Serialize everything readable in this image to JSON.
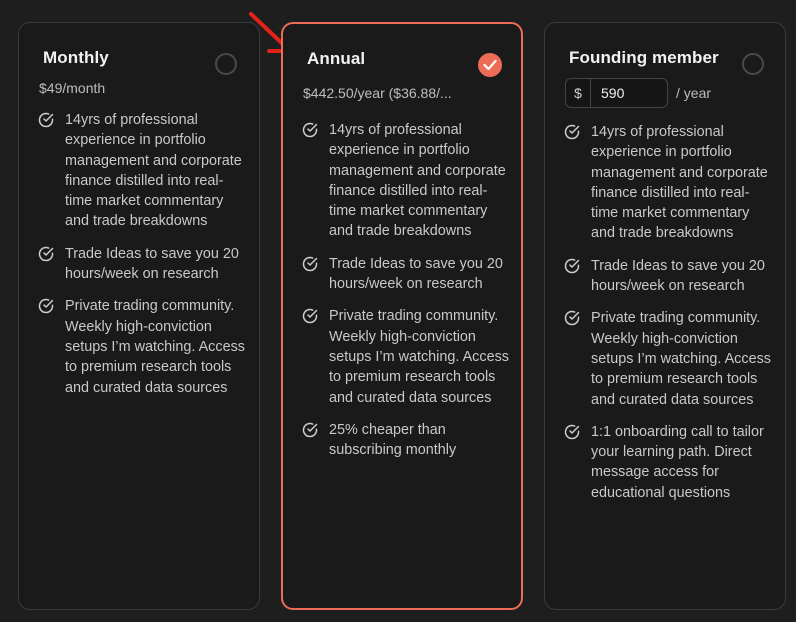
{
  "plans": {
    "monthly": {
      "title": "Monthly",
      "price": "$49/month",
      "features": [
        "14yrs of professional experience in portfolio management and corporate finance distilled into real-time market commentary and trade breakdowns",
        "Trade Ideas to save you 20 hours/week on research",
        "Private trading community. Weekly high-conviction setups I’m watching. Access to premium research tools and curated data sources"
      ]
    },
    "annual": {
      "title": "Annual",
      "price": "$442.50/year ($36.88/...",
      "selected": true,
      "features": [
        "14yrs of professional experience in portfolio management and corporate finance distilled into real-time market commentary and trade breakdowns",
        "Trade Ideas to save you 20 hours/week on research",
        "Private trading community. Weekly high-conviction setups I’m watching. Access to premium research tools and curated data sources",
        "25% cheaper than subscribing monthly"
      ]
    },
    "founding": {
      "title": "Founding member",
      "currency_symbol": "$",
      "price_value": "590",
      "price_suffix": "/ year",
      "features": [
        "14yrs of professional experience in portfolio management and corporate finance distilled into real-time market commentary and trade breakdowns",
        "Trade Ideas to save you 20 hours/week on research",
        "Private trading community. Weekly high-conviction setups I’m watching. Access to premium research tools and curated data sources",
        "1:1 onboarding call to tailor your learning path. Direct message access for educational questions"
      ]
    }
  },
  "colors": {
    "accent": "#ec6c55",
    "arrow": "#e2231a",
    "background": "#1e1e1f"
  },
  "icons": {
    "feature": "check-circle-icon",
    "selected": "checkmark-icon",
    "annotation": "red-arrow-icon"
  }
}
